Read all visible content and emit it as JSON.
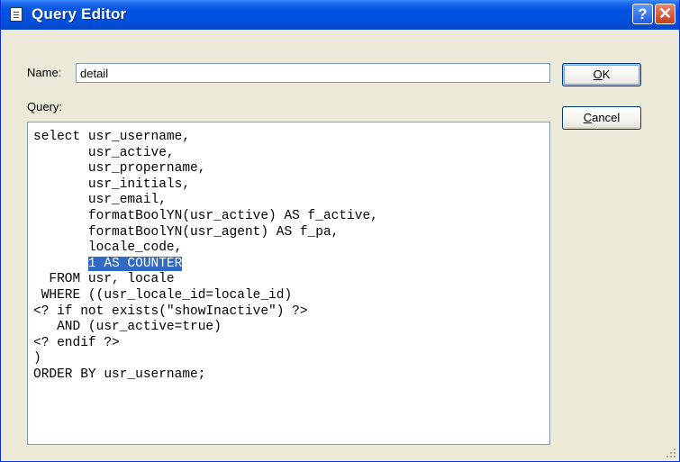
{
  "window": {
    "title": "Query Editor",
    "icon": "document-icon",
    "help_glyph": "?",
    "close_glyph": "✕"
  },
  "form": {
    "name_label": "Name:",
    "name_value": "detail",
    "query_label": "Query:"
  },
  "buttons": {
    "ok_prefix": "",
    "ok_mnemonic": "O",
    "ok_rest": "K",
    "cancel_mnemonic": "C",
    "cancel_rest": "ancel"
  },
  "query": {
    "lines": [
      "select usr_username,",
      "       usr_active,",
      "       usr_propername,",
      "       usr_initials,",
      "       usr_email,",
      "       formatBoolYN(usr_active) AS f_active,",
      "       formatBoolYN(usr_agent) AS f_pa,",
      "       locale_code,",
      "       ",
      "  FROM usr, locale",
      " WHERE ((usr_locale_id=locale_id)",
      "<? if not exists(\"showInactive\") ?>",
      "   AND (usr_active=true)",
      "<? endif ?>",
      ")",
      "ORDER BY usr_username;"
    ],
    "selected_text": "1 AS COUNTER"
  },
  "colors": {
    "titlebar": "#0054e3",
    "selection": "#316ac5",
    "face": "#ece9d8"
  }
}
